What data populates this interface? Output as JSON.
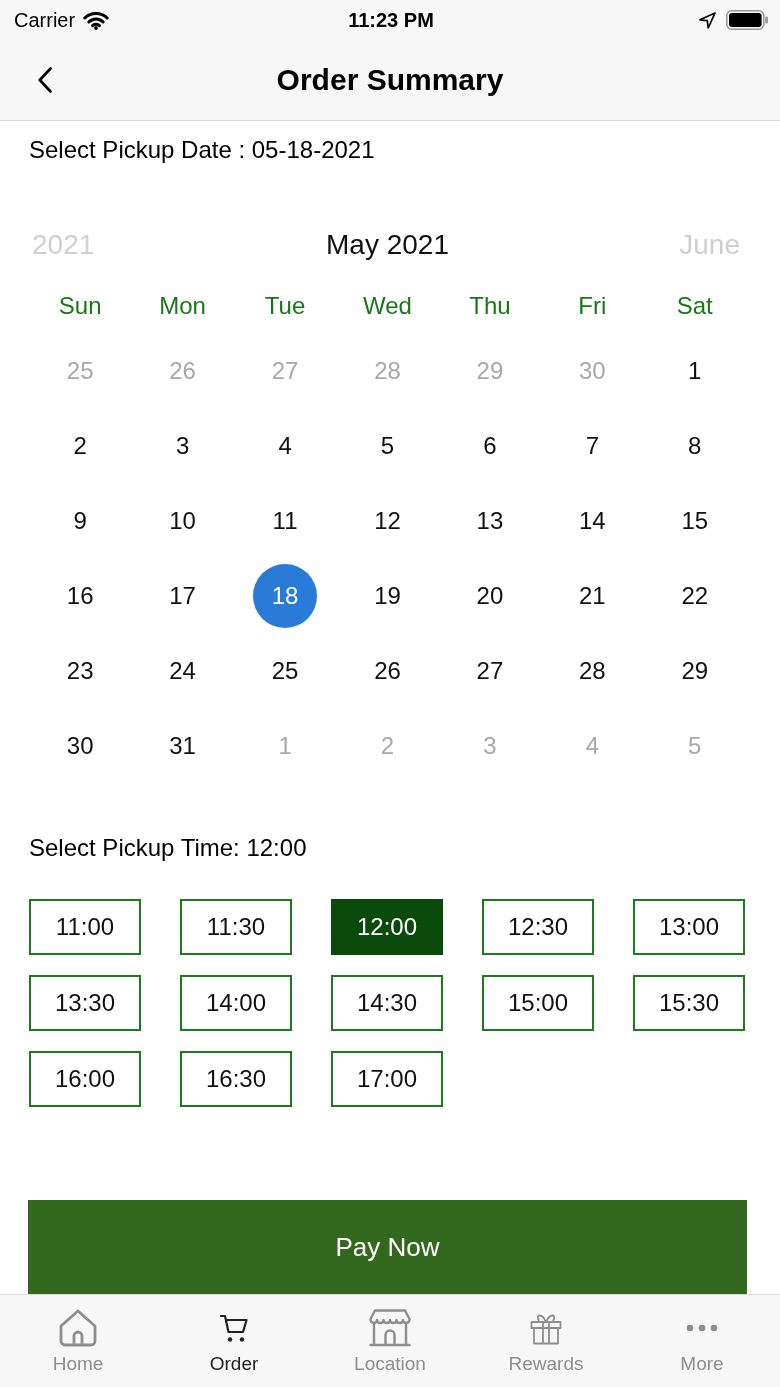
{
  "status_bar": {
    "carrier": "Carrier",
    "time": "11:23 PM"
  },
  "nav_bar": {
    "title": "Order Summary"
  },
  "pickup_date": {
    "label": "Select Pickup Date : 05-18-2021"
  },
  "calendar": {
    "prev_label": "2021",
    "title": "May 2021",
    "next_label": "June",
    "weekdays": [
      "Sun",
      "Mon",
      "Tue",
      "Wed",
      "Thu",
      "Fri",
      "Sat"
    ],
    "weeks": [
      [
        {
          "day": "25",
          "in_month": false,
          "selected": false
        },
        {
          "day": "26",
          "in_month": false,
          "selected": false
        },
        {
          "day": "27",
          "in_month": false,
          "selected": false
        },
        {
          "day": "28",
          "in_month": false,
          "selected": false
        },
        {
          "day": "29",
          "in_month": false,
          "selected": false
        },
        {
          "day": "30",
          "in_month": false,
          "selected": false
        },
        {
          "day": "1",
          "in_month": true,
          "selected": false
        }
      ],
      [
        {
          "day": "2",
          "in_month": true,
          "selected": false
        },
        {
          "day": "3",
          "in_month": true,
          "selected": false
        },
        {
          "day": "4",
          "in_month": true,
          "selected": false
        },
        {
          "day": "5",
          "in_month": true,
          "selected": false
        },
        {
          "day": "6",
          "in_month": true,
          "selected": false
        },
        {
          "day": "7",
          "in_month": true,
          "selected": false
        },
        {
          "day": "8",
          "in_month": true,
          "selected": false
        }
      ],
      [
        {
          "day": "9",
          "in_month": true,
          "selected": false
        },
        {
          "day": "10",
          "in_month": true,
          "selected": false
        },
        {
          "day": "11",
          "in_month": true,
          "selected": false
        },
        {
          "day": "12",
          "in_month": true,
          "selected": false
        },
        {
          "day": "13",
          "in_month": true,
          "selected": false
        },
        {
          "day": "14",
          "in_month": true,
          "selected": false
        },
        {
          "day": "15",
          "in_month": true,
          "selected": false
        }
      ],
      [
        {
          "day": "16",
          "in_month": true,
          "selected": false
        },
        {
          "day": "17",
          "in_month": true,
          "selected": false
        },
        {
          "day": "18",
          "in_month": true,
          "selected": true
        },
        {
          "day": "19",
          "in_month": true,
          "selected": false
        },
        {
          "day": "20",
          "in_month": true,
          "selected": false
        },
        {
          "day": "21",
          "in_month": true,
          "selected": false
        },
        {
          "day": "22",
          "in_month": true,
          "selected": false
        }
      ],
      [
        {
          "day": "23",
          "in_month": true,
          "selected": false
        },
        {
          "day": "24",
          "in_month": true,
          "selected": false
        },
        {
          "day": "25",
          "in_month": true,
          "selected": false
        },
        {
          "day": "26",
          "in_month": true,
          "selected": false
        },
        {
          "day": "27",
          "in_month": true,
          "selected": false
        },
        {
          "day": "28",
          "in_month": true,
          "selected": false
        },
        {
          "day": "29",
          "in_month": true,
          "selected": false
        }
      ],
      [
        {
          "day": "30",
          "in_month": true,
          "selected": false
        },
        {
          "day": "31",
          "in_month": true,
          "selected": false
        },
        {
          "day": "1",
          "in_month": false,
          "selected": false
        },
        {
          "day": "2",
          "in_month": false,
          "selected": false
        },
        {
          "day": "3",
          "in_month": false,
          "selected": false
        },
        {
          "day": "4",
          "in_month": false,
          "selected": false
        },
        {
          "day": "5",
          "in_month": false,
          "selected": false
        }
      ]
    ]
  },
  "pickup_time": {
    "label": "Select Pickup Time: 12:00"
  },
  "time_slots": [
    {
      "label": "11:00",
      "selected": false
    },
    {
      "label": "11:30",
      "selected": false
    },
    {
      "label": "12:00",
      "selected": true
    },
    {
      "label": "12:30",
      "selected": false
    },
    {
      "label": "13:00",
      "selected": false
    },
    {
      "label": "13:30",
      "selected": false
    },
    {
      "label": "14:00",
      "selected": false
    },
    {
      "label": "14:30",
      "selected": false
    },
    {
      "label": "15:00",
      "selected": false
    },
    {
      "label": "15:30",
      "selected": false
    },
    {
      "label": "16:00",
      "selected": false
    },
    {
      "label": "16:30",
      "selected": false
    },
    {
      "label": "17:00",
      "selected": false
    }
  ],
  "pay_button": {
    "label": "Pay Now"
  },
  "tab_bar": [
    {
      "kind": "home",
      "label": "Home",
      "selected": false
    },
    {
      "kind": "cart",
      "label": "Order",
      "selected": true
    },
    {
      "kind": "store",
      "label": "Location",
      "selected": false
    },
    {
      "kind": "gift",
      "label": "Rewards",
      "selected": false
    },
    {
      "kind": "more",
      "label": "More",
      "selected": false
    }
  ]
}
